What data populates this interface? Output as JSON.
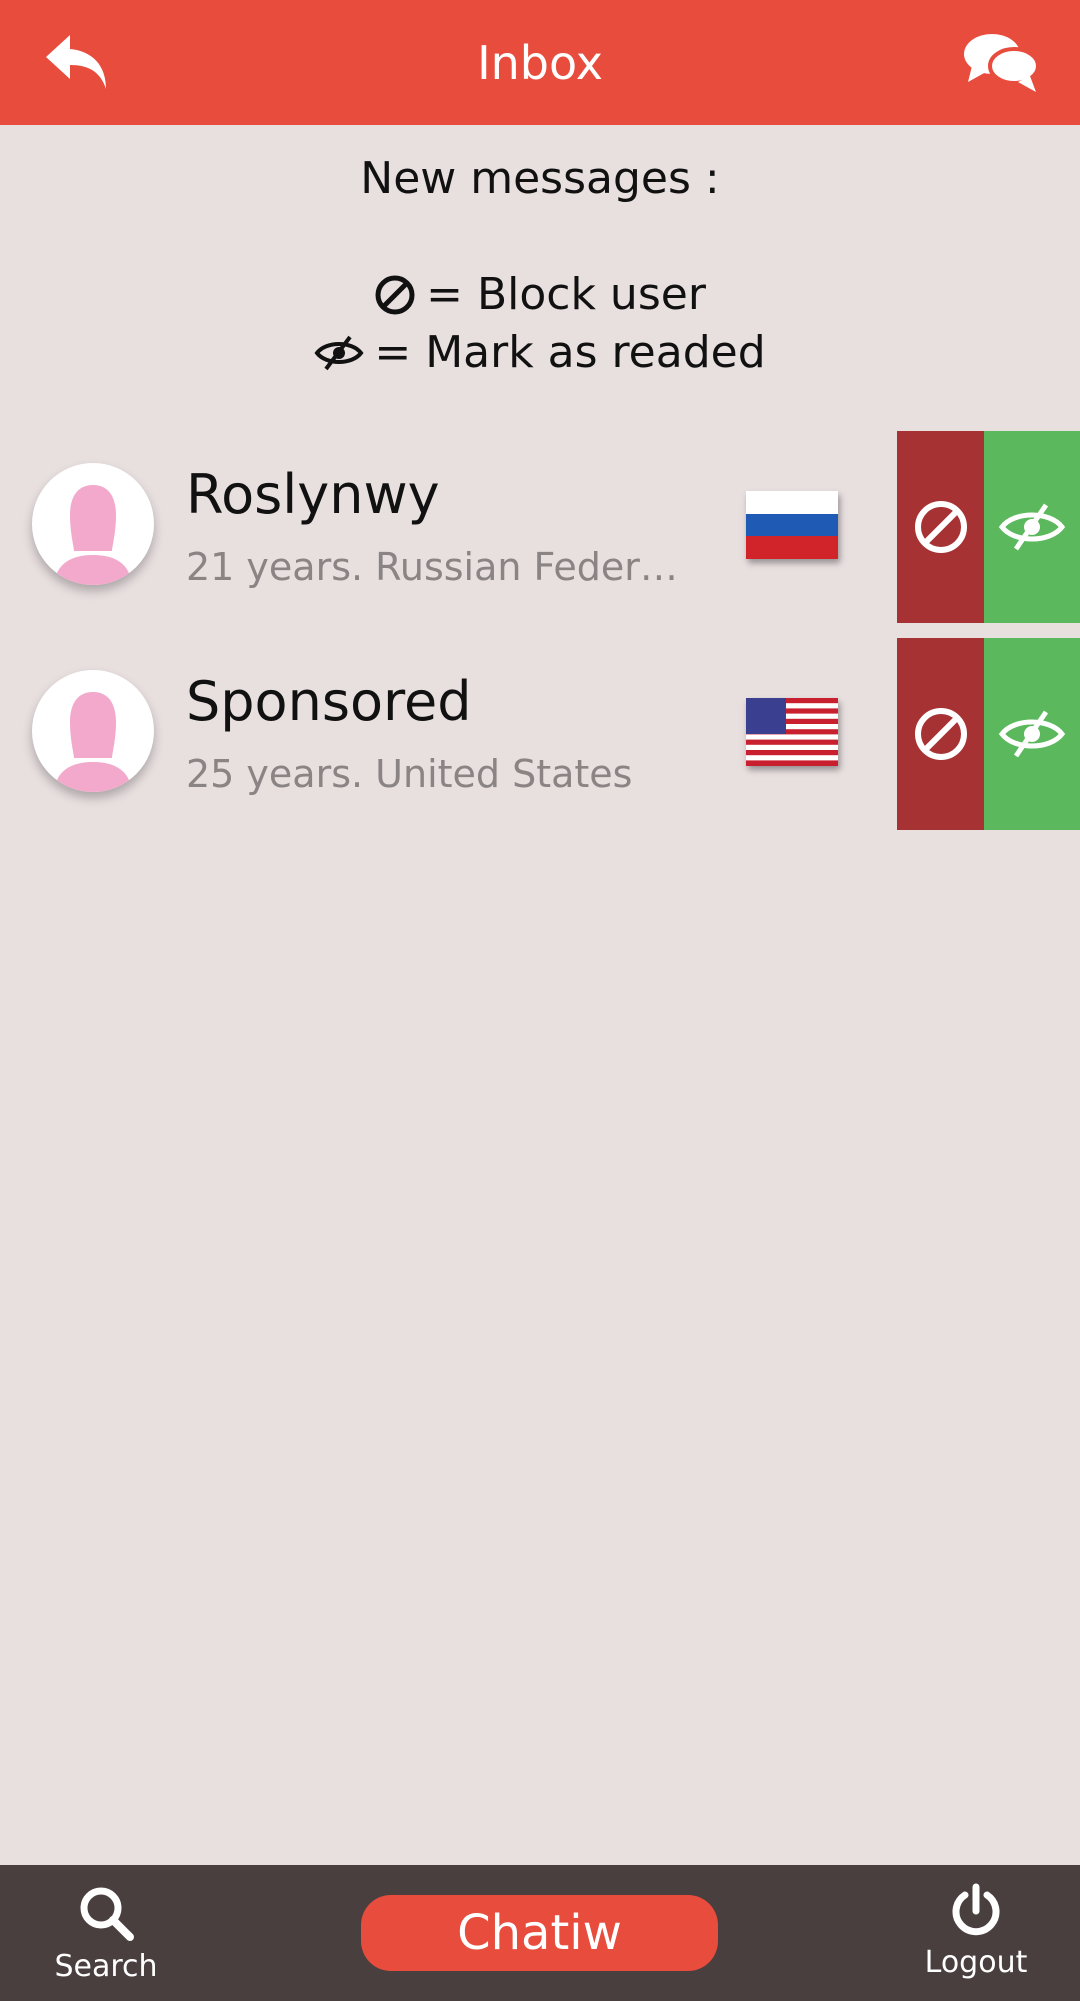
{
  "header": {
    "title": "Inbox",
    "back_icon": "back-arrow-icon",
    "chat_icon": "chat-bubbles-icon",
    "color": "#e84c3d"
  },
  "legend": {
    "heading": "New messages :",
    "block_text": "= Block user",
    "read_text": "= Mark as readed"
  },
  "messages": [
    {
      "name": "Roslynwy",
      "details": "21 years. Russian Federa…",
      "flag": "russia-flag"
    },
    {
      "name": "Sponsored",
      "details": "25 years. United States",
      "flag": "usa-flag"
    }
  ],
  "actions": {
    "block_color": "#a63234",
    "read_color": "#5cb85c"
  },
  "bottom_nav": {
    "search_label": "Search",
    "brand_label": "Chatiw",
    "logout_label": "Logout"
  }
}
